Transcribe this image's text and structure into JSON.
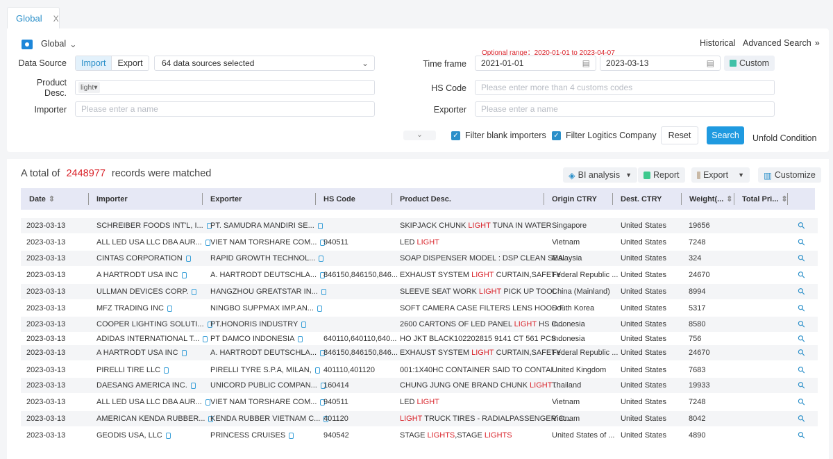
{
  "tab": {
    "label": "Global",
    "close": "X"
  },
  "region": {
    "label": "Global"
  },
  "links": {
    "historical": "Historical",
    "advanced": "Advanced Search",
    "advanced_icon": "double-chevron-right"
  },
  "form": {
    "data_source_label": "Data Source",
    "import": "Import",
    "export": "Export",
    "sources": "64 data sources selected",
    "product_label_1": "Product",
    "product_label_2": "Desc.",
    "product_tag": "light",
    "importer_label": "Importer",
    "importer_ph": "Please enter a name",
    "range_note": "Optional range：2020-01-01 to 2023-04-07",
    "time_label": "Time frame",
    "date_from": "2021-01-01",
    "date_to": "2023-03-13",
    "custom": "Custom",
    "hs_label": "HS Code",
    "hs_ph": "Please enter more than 4 customs codes",
    "exporter_label": "Exporter",
    "exporter_ph": "Please enter a name",
    "filter_blank": "Filter blank importers",
    "filter_logistics": "Filter Logitics Company",
    "filter_blank_checked": true,
    "filter_logistics_checked": true,
    "reset": "Reset",
    "search": "Search",
    "unfold": "Unfold Condition"
  },
  "results": {
    "prefix": "A total of",
    "count": "2448977",
    "suffix": "records were matched",
    "bi": "BI analysis",
    "report": "Report",
    "export": "Export",
    "customize": "Customize"
  },
  "columns": [
    "Date",
    "Importer",
    "Exporter",
    "HS Code",
    "Product Desc.",
    "Origin CTRY",
    "Dest. CTRY",
    "Weight(...",
    "Total Pri..."
  ],
  "colors": {
    "accent": "#2a8fc9",
    "highlight": "#d9232a",
    "header_bg": "#e6e8f5"
  },
  "rows": [
    {
      "date": "2023-03-13",
      "importer": "SCHREIBER FOODS INT'L, I...",
      "exporter": "PT. SAMUDRA MANDIRI SE...",
      "hs": "",
      "product": [
        [
          "SKIPJACK CHUNK ",
          0
        ],
        [
          "LIGHT",
          1
        ],
        [
          " TUNA IN WATER",
          0
        ]
      ],
      "origin": "Singapore",
      "dest": "United States",
      "weight": "19656"
    },
    {
      "date": "2023-03-13",
      "importer": "ALL LED USA LLC DBA AUR...",
      "exporter": "VIET NAM TORSHARE COM...",
      "hs": "940511",
      "product": [
        [
          "LED ",
          0
        ],
        [
          "LIGHT",
          1
        ]
      ],
      "origin": "Vietnam",
      "dest": "United States",
      "weight": "7248"
    },
    {
      "date": "2023-03-13",
      "importer": "CINTAS CORPORATION",
      "exporter": "RAPID GROWTH TECHNOL...",
      "hs": "",
      "product": [
        [
          "SOAP DISPENSER MODEL : DSP CLEAN SEA...",
          0
        ]
      ],
      "origin": "Malaysia",
      "dest": "United States",
      "weight": "324"
    },
    {
      "date": "2023-03-13",
      "importer": "A HARTRODT USA INC",
      "exporter": "A. HARTRODT DEUTSCHLA...",
      "hs": "846150,846150,846...",
      "product": [
        [
          "EXHAUST SYSTEM ",
          0
        ],
        [
          "LIGHT",
          1
        ],
        [
          " CURTAIN,SAFETY ...",
          0
        ]
      ],
      "origin": "Federal Republic ...",
      "dest": "United States",
      "weight": "24670"
    },
    {
      "date": "2023-03-13",
      "importer": "ULLMAN DEVICES CORP.",
      "exporter": "HANGZHOU GREATSTAR IN...",
      "hs": "",
      "product": [
        [
          "SLEEVE SEAT WORK ",
          0
        ],
        [
          "LIGHT",
          1
        ],
        [
          " PICK UP TOOL",
          0
        ]
      ],
      "origin": "China (Mainland)",
      "dest": "United States",
      "weight": "8994"
    },
    {
      "date": "2023-03-13",
      "importer": "MFZ TRADING INC",
      "exporter": "NINGBO SUPPMAX IMP.AN...",
      "hs": "",
      "product": [
        [
          "SOFT CAMERA CASE FILTERS LENS HOOD F...",
          0
        ]
      ],
      "origin": "South Korea",
      "dest": "United States",
      "weight": "5317"
    },
    {
      "date": "2023-03-13",
      "importer": "COOPER LIGHTING SOLUTI...",
      "exporter": "PT.HONORIS INDUSTRY",
      "hs": "",
      "product": [
        [
          "2600 CARTONS OF LED PANEL ",
          0
        ],
        [
          "LIGHT",
          1
        ],
        [
          " HS C...",
          0
        ]
      ],
      "origin": "Indonesia",
      "dest": "United States",
      "weight": "8580"
    },
    {
      "date": "2023-03-13",
      "importer": "ADIDAS INTERNATIONAL T...",
      "exporter": "PT DAMCO INDONESIA",
      "hs": "640110,640110,640...",
      "product": [
        [
          "HO JKT BLACK102202815 9141 CT 561 PCS ...",
          0
        ]
      ],
      "origin": "Indonesia",
      "dest": "United States",
      "weight": "756"
    },
    {
      "date": "2023-03-13",
      "importer": "A HARTRODT USA INC",
      "exporter": "A. HARTRODT DEUTSCHLA...",
      "hs": "846150,846150,846...",
      "product": [
        [
          "EXHAUST SYSTEM ",
          0
        ],
        [
          "LIGHT",
          1
        ],
        [
          " CURTAIN,SAFETY ...",
          0
        ]
      ],
      "origin": "Federal Republic ...",
      "dest": "United States",
      "weight": "24670"
    },
    {
      "date": "2023-03-13",
      "importer": "PIRELLI TIRE LLC",
      "exporter": "PIRELLI TYRE S.P.A, MILAN,",
      "hs": "401110,401120",
      "product": [
        [
          "001:1X40HC CONTAINER SAID TO CONTAI...",
          0
        ]
      ],
      "origin": "United Kingdom",
      "dest": "United States",
      "weight": "7683"
    },
    {
      "date": "2023-03-13",
      "importer": "DAESANG AMERICA INC.",
      "exporter": "UNICORD PUBLIC COMPAN...",
      "hs": "160414",
      "product": [
        [
          "CHUNG JUNG ONE BRAND CHUNK ",
          0
        ],
        [
          "LIGHT",
          1
        ],
        [
          " ...",
          0
        ]
      ],
      "origin": "Thailand",
      "dest": "United States",
      "weight": "19933"
    },
    {
      "date": "2023-03-13",
      "importer": "ALL LED USA LLC DBA AUR...",
      "exporter": "VIET NAM TORSHARE COM...",
      "hs": "940511",
      "product": [
        [
          "LED ",
          0
        ],
        [
          "LIGHT",
          1
        ]
      ],
      "origin": "Vietnam",
      "dest": "United States",
      "weight": "7248"
    },
    {
      "date": "2023-03-13",
      "importer": "AMERICAN KENDA RUBBER...",
      "exporter": "KENDA RUBBER VIETNAM C...",
      "hs": "401120",
      "product": [
        [
          "LIGHT",
          1
        ],
        [
          " TRUCK TIRES - RADIALPASSENGER C...",
          0
        ]
      ],
      "origin": "Vietnam",
      "dest": "United States",
      "weight": "8042"
    },
    {
      "date": "2023-03-13",
      "importer": "GEODIS USA, LLC",
      "exporter": "PRINCESS CRUISES",
      "hs": "940542",
      "product": [
        [
          "STAGE ",
          0
        ],
        [
          "LIGHTS",
          1
        ],
        [
          ",STAGE ",
          0
        ],
        [
          "LIGHTS",
          1
        ]
      ],
      "origin": "United States of ...",
      "dest": "United States",
      "weight": "4890"
    }
  ]
}
